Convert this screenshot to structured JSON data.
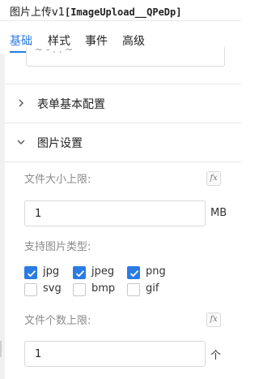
{
  "header": {
    "title_prefix": "图片上传v1",
    "title_id": "[ImageUpload__QPeDp]"
  },
  "tabs": [
    {
      "label": "基础",
      "active": true
    },
    {
      "label": "样式",
      "active": false
    },
    {
      "label": "事件",
      "active": false
    },
    {
      "label": "高级",
      "active": false
    }
  ],
  "remnant_text": "~ - . . ~",
  "sections": {
    "form_config": {
      "label": "表单基本配置",
      "expanded": false
    },
    "image_settings": {
      "label": "图片设置",
      "expanded": true
    }
  },
  "fields": {
    "file_size": {
      "label": "文件大小上限:",
      "value": "1",
      "unit": "MB",
      "fx": "fx"
    },
    "image_types": {
      "label": "支持图片类型:",
      "options": [
        {
          "label": "jpg",
          "checked": true
        },
        {
          "label": "jpeg",
          "checked": true
        },
        {
          "label": "png",
          "checked": true
        },
        {
          "label": "svg",
          "checked": false
        },
        {
          "label": "bmp",
          "checked": false
        },
        {
          "label": "gif",
          "checked": false
        }
      ]
    },
    "file_count": {
      "label": "文件个数上限:",
      "value": "1",
      "unit": "个",
      "fx": "fx"
    }
  },
  "colors": {
    "accent": "#2a7be4",
    "label": "#8a8a8a"
  }
}
